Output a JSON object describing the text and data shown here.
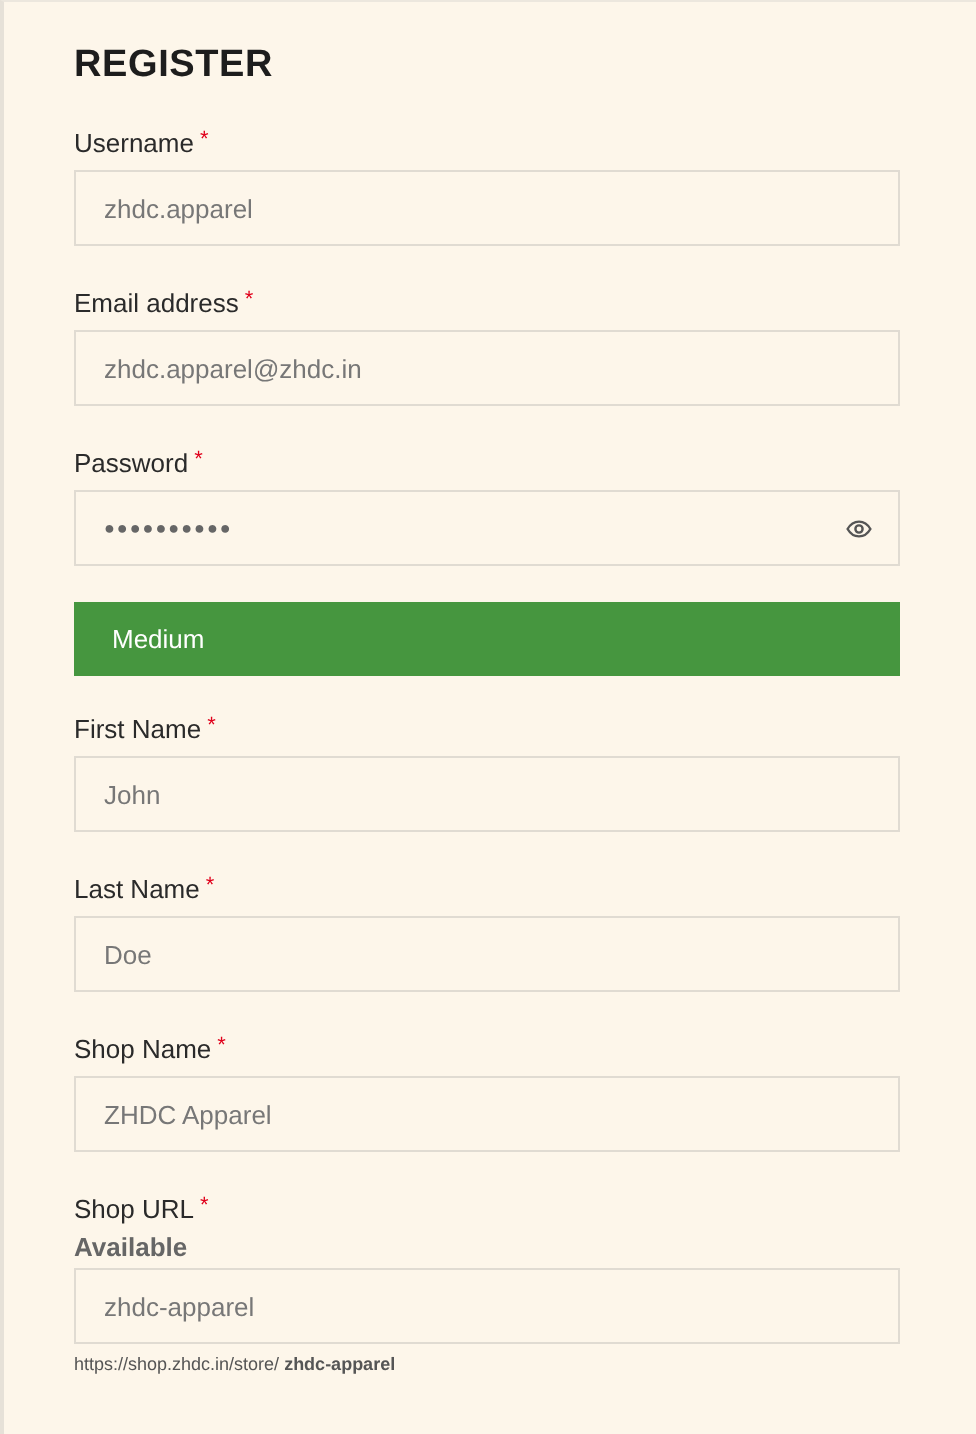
{
  "title": "REGISTER",
  "fields": [
    {
      "kind": "text",
      "label": "Username",
      "required_mark": "*",
      "placeholder": "zhdc.apparel"
    },
    {
      "kind": "text",
      "label": "Email address",
      "required_mark": "*",
      "placeholder": "zhdc.apparel@zhdc.in"
    },
    {
      "kind": "password",
      "label": "Password",
      "required_mark": "*",
      "value": "●●●●●●●●●●",
      "strength": {
        "kind": "medium",
        "label": "Medium"
      }
    },
    {
      "kind": "text",
      "label": "First Name",
      "required_mark": "*",
      "placeholder": "John"
    },
    {
      "kind": "text",
      "label": "Last Name",
      "required_mark": "*",
      "placeholder": "Doe"
    },
    {
      "kind": "text",
      "label": "Shop Name",
      "required_mark": "*",
      "placeholder": "ZHDC Apparel"
    },
    {
      "kind": "text",
      "label": "Shop URL",
      "required_mark": "*",
      "availability": "Available",
      "placeholder": "zhdc-apparel",
      "hint": "https://shop.zhdc.in/store/ **zhdc-apparel**"
    }
  ]
}
